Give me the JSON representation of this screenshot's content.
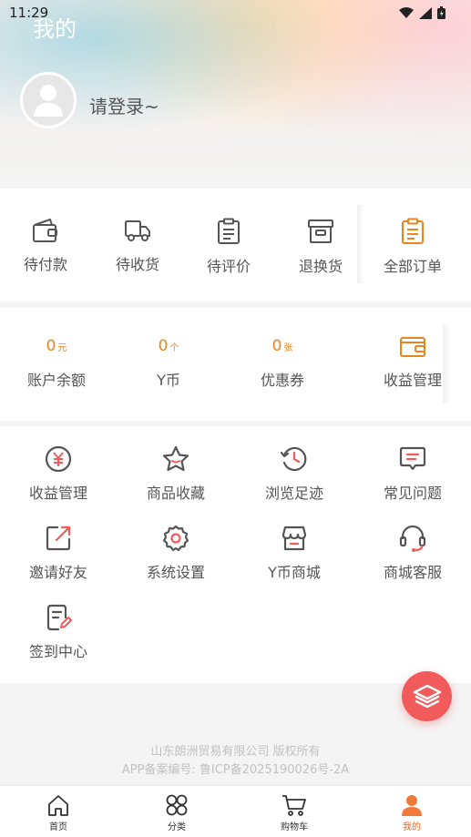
{
  "status": {
    "time": "11:29"
  },
  "header": {
    "title": "我的",
    "login_prompt": "请登录~"
  },
  "orders": {
    "items": [
      {
        "label": "待付款",
        "icon": "wallet-icon"
      },
      {
        "label": "待收货",
        "icon": "truck-icon"
      },
      {
        "label": "待评价",
        "icon": "clipboard-icon"
      },
      {
        "label": "退换货",
        "icon": "box-icon"
      },
      {
        "label": "全部订单",
        "icon": "all-orders-icon"
      }
    ]
  },
  "account": {
    "items": [
      {
        "value": "0",
        "unit": "元",
        "label": "账户余额"
      },
      {
        "value": "0",
        "unit": "个",
        "label": "Y币"
      },
      {
        "value": "0",
        "unit": "张",
        "label": "优惠券"
      }
    ],
    "income": {
      "label": "收益管理",
      "icon": "wallet-icon"
    }
  },
  "tools": {
    "items": [
      {
        "label": "收益管理",
        "icon": "yuan-icon"
      },
      {
        "label": "商品收藏",
        "icon": "star-icon"
      },
      {
        "label": "浏览足迹",
        "icon": "history-icon"
      },
      {
        "label": "常见问题",
        "icon": "message-icon"
      },
      {
        "label": "邀请好友",
        "icon": "share-icon"
      },
      {
        "label": "系统设置",
        "icon": "gear-icon"
      },
      {
        "label": "Y币商城",
        "icon": "store-icon"
      },
      {
        "label": "商城客服",
        "icon": "headset-icon"
      },
      {
        "label": "签到中心",
        "icon": "checkin-icon"
      }
    ]
  },
  "footer": {
    "copyright": "山东朗洲贸易有限公司 版权所有",
    "icp": "APP备案编号: 鲁ICP备2025190026号-2A"
  },
  "tabbar": {
    "tabs": [
      {
        "label": "首页",
        "icon": "home-icon"
      },
      {
        "label": "分类",
        "icon": "category-icon"
      },
      {
        "label": "购物车",
        "icon": "cart-icon"
      },
      {
        "label": "我的",
        "icon": "user-icon",
        "active": true
      }
    ]
  },
  "colors": {
    "accent": "#e8851f",
    "fab": "#f15b5b",
    "active_tab": "#e8651f"
  }
}
